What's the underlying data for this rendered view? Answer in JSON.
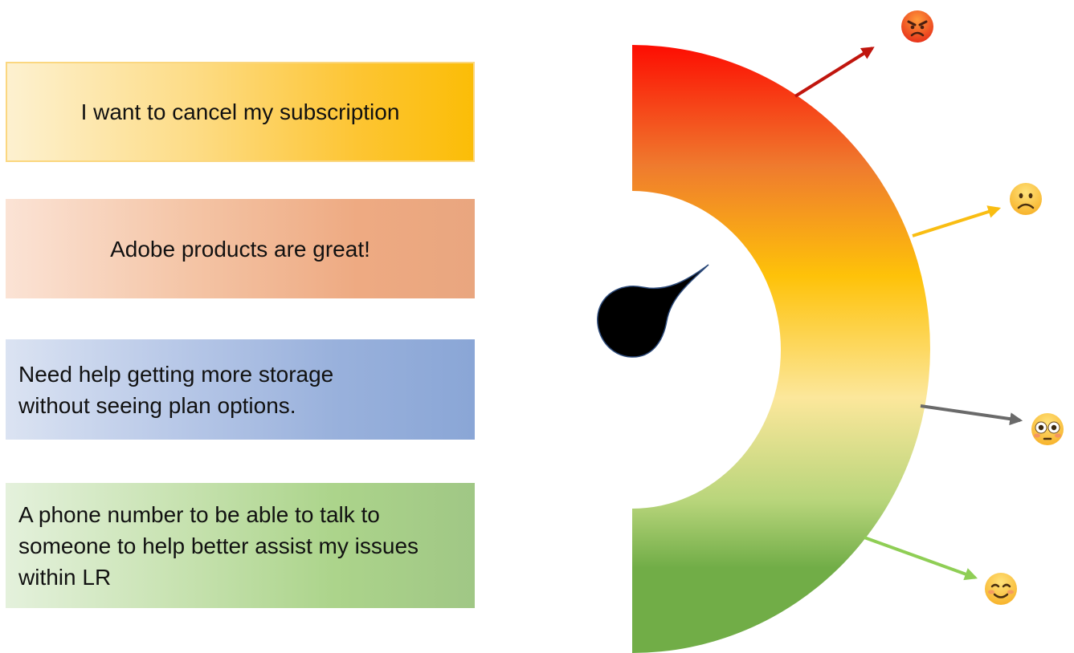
{
  "feedback_cards": [
    {
      "text": "I want to cancel my subscription",
      "color": "#fdc533"
    },
    {
      "text": "Adobe products are great!",
      "color": "#eeaa82"
    },
    {
      "text": "Need help getting more storage without seeing plan options.",
      "color": "#99b1dc"
    },
    {
      "text": "A phone number to be able to talk to someone to help better assist my issues within LR",
      "color": "#acd48b"
    }
  ],
  "gauge": {
    "gradient_colors": [
      "#fd0d02",
      "#ef7b2e",
      "#fec209",
      "#fce79b",
      "#b8d57b",
      "#71ad47"
    ],
    "needle_color": "#000000"
  },
  "sentiments": [
    {
      "icon": "angry-face-icon",
      "arrow_color": "#c0150d"
    },
    {
      "icon": "frowning-face-icon",
      "arrow_color": "#f9bd12"
    },
    {
      "icon": "flushed-face-icon",
      "arrow_color": "#6a6a6a"
    },
    {
      "icon": "smiling-face-icon",
      "arrow_color": "#8fce55"
    }
  ]
}
